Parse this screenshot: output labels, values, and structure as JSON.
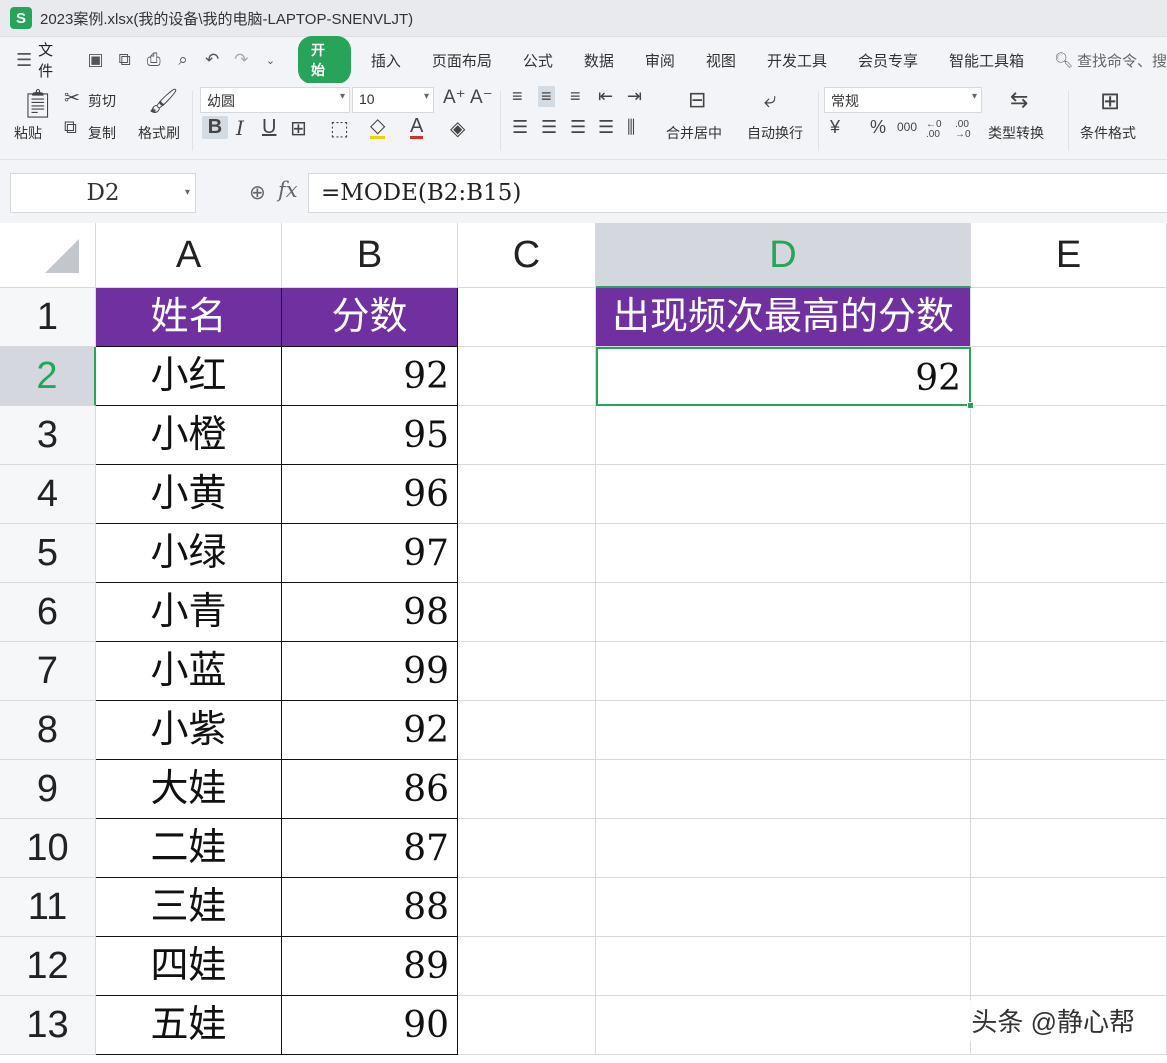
{
  "window": {
    "title": "2023案例.xlsx(我的设备\\我的电脑-LAPTOP-SNENVLJT)",
    "app_icon": "S"
  },
  "menu": {
    "file": "文件",
    "tabs": [
      "开始",
      "插入",
      "页面布局",
      "公式",
      "数据",
      "审阅",
      "视图",
      "开发工具",
      "会员专享",
      "智能工具箱"
    ],
    "search": "查找命令、搜"
  },
  "ribbon": {
    "paste": "粘贴",
    "cut": "剪切",
    "copy": "复制",
    "format_painter": "格式刷",
    "font_name": "幼圆",
    "font_size": "10",
    "bold": "B",
    "italic": "I",
    "underline": "U",
    "merge_center": "合并居中",
    "wrap_text": "自动换行",
    "number_format": "常规",
    "percent": "%",
    "thousands": "000",
    "inc_decimal": "←0 .00",
    "dec_decimal": ".00 →0",
    "type_convert": "类型转换",
    "conditional_format": "条件格式"
  },
  "formula_bar": {
    "name_box": "D2",
    "fx": "fx",
    "formula": "=MODE(B2:B15)"
  },
  "columns": [
    "A",
    "B",
    "C",
    "D",
    "E"
  ],
  "selected_column": "D",
  "rows": [
    "1",
    "2",
    "3",
    "4",
    "5",
    "6",
    "7",
    "8",
    "9",
    "10",
    "11",
    "12",
    "13"
  ],
  "selected_row": "2",
  "table": {
    "header_name": "姓名",
    "header_score": "分数",
    "records": [
      {
        "name": "小红",
        "score": "92"
      },
      {
        "name": "小橙",
        "score": "95"
      },
      {
        "name": "小黄",
        "score": "96"
      },
      {
        "name": "小绿",
        "score": "97"
      },
      {
        "name": "小青",
        "score": "98"
      },
      {
        "name": "小蓝",
        "score": "99"
      },
      {
        "name": "小紫",
        "score": "92"
      },
      {
        "name": "大娃",
        "score": "86"
      },
      {
        "name": "二娃",
        "score": "87"
      },
      {
        "name": "三娃",
        "score": "88"
      },
      {
        "name": "四娃",
        "score": "89"
      },
      {
        "name": "五娃",
        "score": "90"
      }
    ]
  },
  "result": {
    "label": "出现频次最高的分数",
    "value": "92"
  },
  "watermark": "头条 @静心帮",
  "colors": {
    "accent": "#27a35a",
    "header_fill": "#7030a0"
  }
}
